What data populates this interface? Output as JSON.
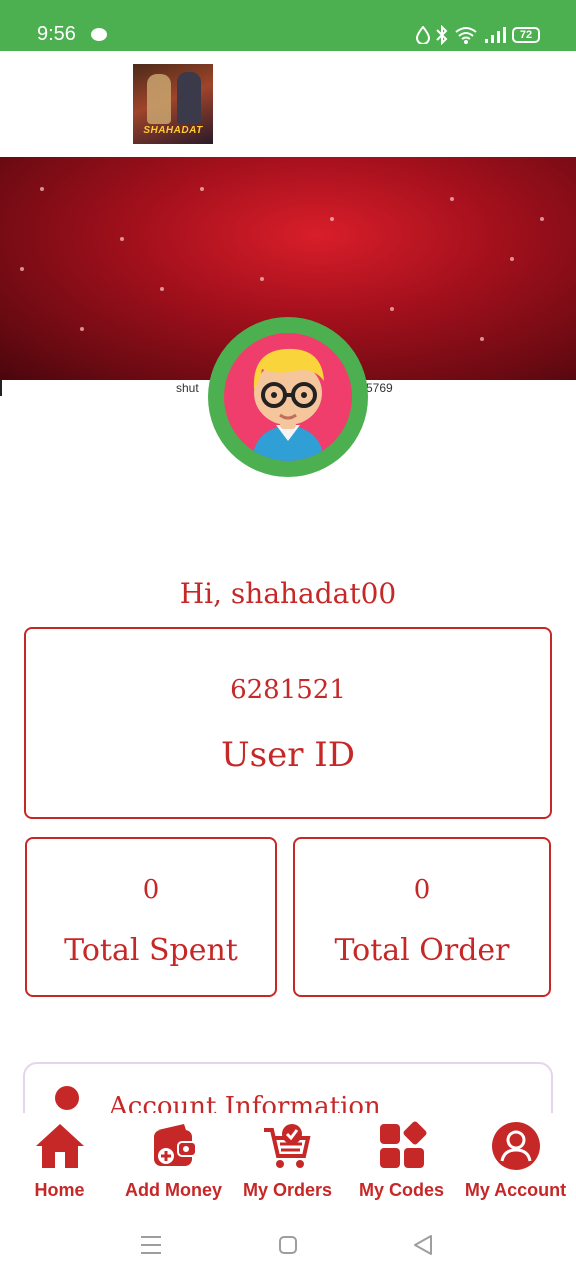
{
  "status_bar": {
    "time": "9:56",
    "battery": "72"
  },
  "header": {
    "logo_text": "SHAHADAT"
  },
  "banner": {
    "caption_left": "shut",
    "caption_right": "5769"
  },
  "greeting": "Hi, shahadat00",
  "user_card": {
    "value": "6281521",
    "label": "User ID"
  },
  "stats": {
    "spent": {
      "value": "0",
      "label": "Total Spent"
    },
    "orders": {
      "value": "0",
      "label": "Total Order"
    }
  },
  "account": {
    "title": "Account Information"
  },
  "bottom_nav": [
    {
      "label": "Home",
      "icon": "home-icon"
    },
    {
      "label": "Add Money",
      "icon": "wallet-icon"
    },
    {
      "label": "My Orders",
      "icon": "cart-icon"
    },
    {
      "label": "My Codes",
      "icon": "grid-icon"
    },
    {
      "label": "My Account",
      "icon": "user-circle-icon"
    }
  ],
  "colors": {
    "accent": "#c62828",
    "status_bar": "#4caf50",
    "avatar_ring": "#4caf50",
    "avatar_bg": "#ef3e6b"
  }
}
